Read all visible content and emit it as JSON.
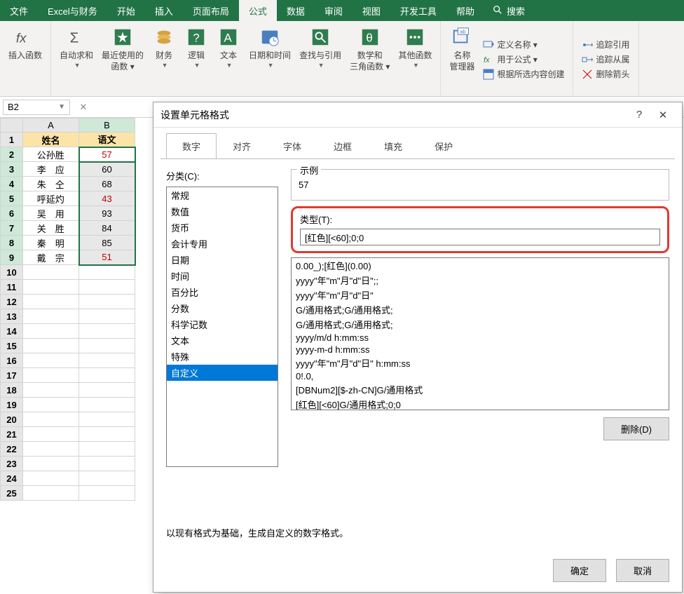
{
  "ribbon_tabs": {
    "file": "文件",
    "excel_finance": "Excel与财务",
    "home": "开始",
    "insert": "插入",
    "page_layout": "页面布局",
    "formulas": "公式",
    "data": "数据",
    "review": "审阅",
    "view": "视图",
    "dev": "开发工具",
    "help": "帮助",
    "search": "搜索"
  },
  "ribbon": {
    "insert_fn": "插入函数",
    "autosum": "自动求和",
    "recent": "最近使用的\n函数 ▾",
    "finance": "财务",
    "logic": "逻辑",
    "text": "文本",
    "datetime": "日期和时间",
    "lookup": "查找与引用",
    "mathtrig": "数学和\n三角函数 ▾",
    "other": "其他函数",
    "name_mgr": "名称\n管理器",
    "define_name": "定义名称 ▾",
    "use_in_formula": "用于公式 ▾",
    "create_from_sel": "根据所选内容创建",
    "trace_prec": "追踪引用",
    "trace_dep": "追踪从属",
    "remove_arrows": "删除箭头"
  },
  "namebox": "B2",
  "sheet": {
    "cols": [
      "A",
      "B"
    ],
    "headers": {
      "name": "姓名",
      "score": "语文"
    },
    "rows": [
      {
        "n": "公孙胜",
        "v": "57",
        "red": true
      },
      {
        "n": "李　应",
        "v": "60",
        "red": false
      },
      {
        "n": "朱　仝",
        "v": "68",
        "red": false
      },
      {
        "n": "呼延灼",
        "v": "43",
        "red": true
      },
      {
        "n": "吴　用",
        "v": "93",
        "red": false
      },
      {
        "n": "关　胜",
        "v": "84",
        "red": false
      },
      {
        "n": "秦　明",
        "v": "85",
        "red": false
      },
      {
        "n": "戴　宗",
        "v": "51",
        "red": true
      }
    ]
  },
  "dialog": {
    "title": "设置单元格格式",
    "help": "?",
    "close": "✕",
    "tabs": {
      "number": "数字",
      "align": "对齐",
      "font": "字体",
      "border": "边框",
      "fill": "填充",
      "protect": "保护"
    },
    "category_label": "分类(C):",
    "categories": [
      "常规",
      "数值",
      "货币",
      "会计专用",
      "日期",
      "时间",
      "百分比",
      "分数",
      "科学记数",
      "文本",
      "特殊",
      "自定义"
    ],
    "selected_category_index": 11,
    "example_label": "示例",
    "example_value": "57",
    "type_label": "类型(T):",
    "type_value": "[红色][<60];0;0",
    "format_list": [
      "0.00_);[红色](0.00)",
      "yyyy\"年\"m\"月\"d\"日\";;",
      "yyyy\"年\"m\"月\"d\"日\"",
      "G/通用格式;G/通用格式;",
      "G/通用格式;G/通用格式;",
      "yyyy/m/d h:mm:ss",
      "yyyy-m-d h:mm:ss",
      "yyyy\"年\"m\"月\"d\"日\" h:mm:ss",
      "0!.0,",
      "[DBNum2][$-zh-CN]G/通用格式",
      "[红色][<60]G/通用格式;0;0"
    ],
    "delete_btn": "删除(D)",
    "hint": "以现有格式为基础，生成自定义的数字格式。",
    "ok": "确定",
    "cancel": "取消"
  }
}
